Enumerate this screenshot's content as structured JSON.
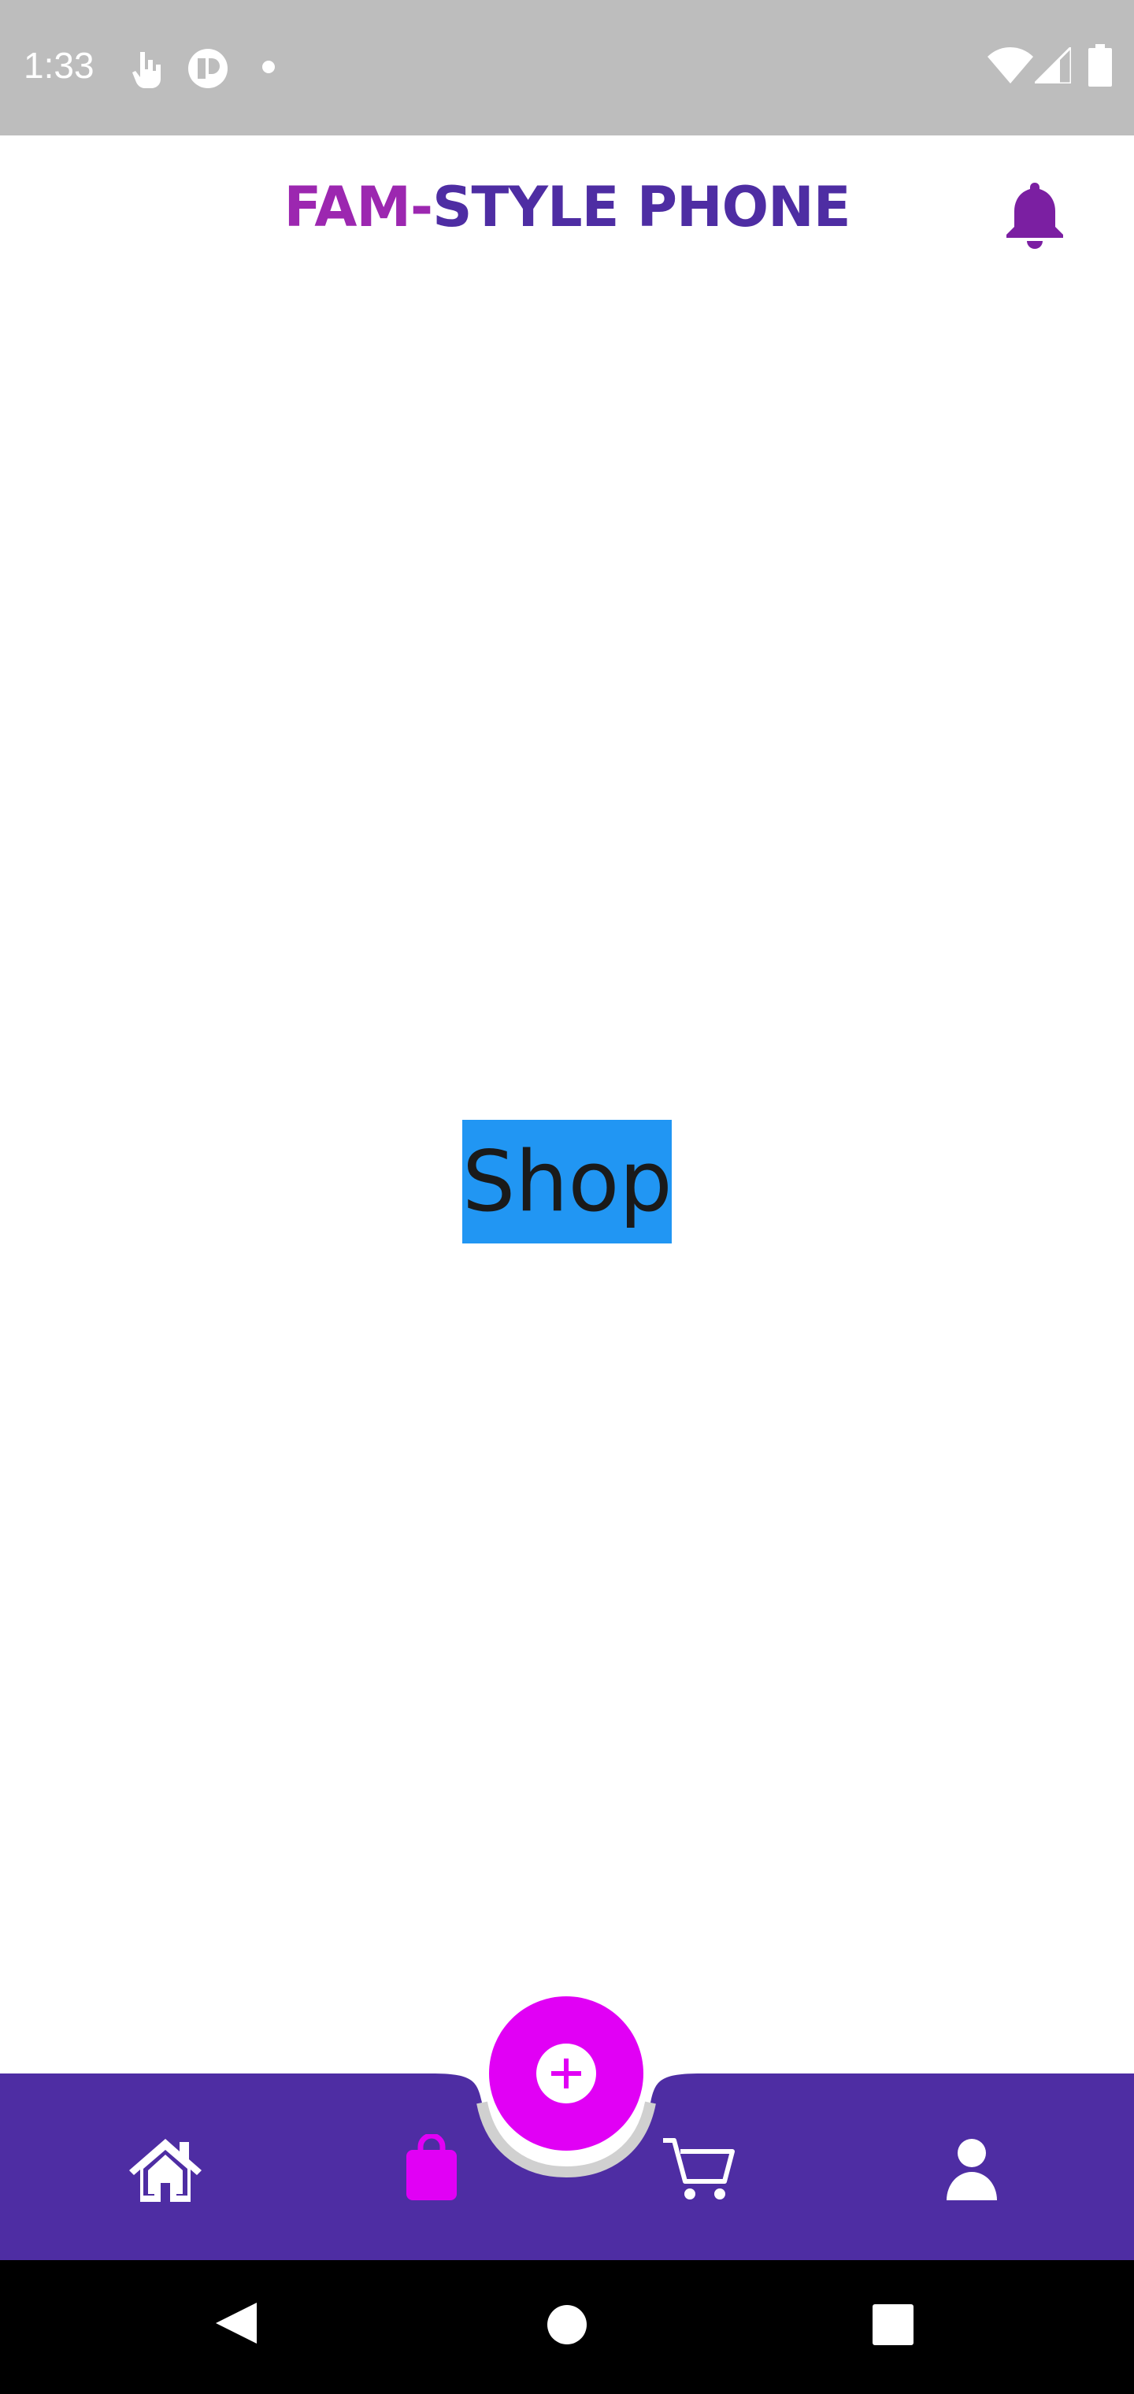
{
  "status_bar": {
    "time": "1:33",
    "left_icons": [
      "touch-icon",
      "app-notification-icon",
      "dot-icon"
    ],
    "right_icons": [
      "wifi-icon",
      "signal-icon",
      "battery-icon"
    ]
  },
  "header": {
    "title_part1": "FAM-",
    "title_part2": "STYLE PHONE",
    "notification_icon": "bell-icon",
    "title_colors": {
      "part1": "#9c27b0",
      "part2": "#4e2da3"
    }
  },
  "main": {
    "label": "Shop",
    "label_bg": "#2196f3"
  },
  "bottom_nav": {
    "bg_color": "#4e2da3",
    "active_color": "#e100f5",
    "items": [
      {
        "icon": "home-icon",
        "active": false
      },
      {
        "icon": "shopping-bag-icon",
        "active": true
      },
      {
        "icon": "cart-icon",
        "active": false
      },
      {
        "icon": "user-icon",
        "active": false
      }
    ],
    "fab_icon": "plus-circle-icon"
  },
  "system_nav": {
    "buttons": [
      "back-icon",
      "home-circle-icon",
      "recents-icon"
    ]
  }
}
